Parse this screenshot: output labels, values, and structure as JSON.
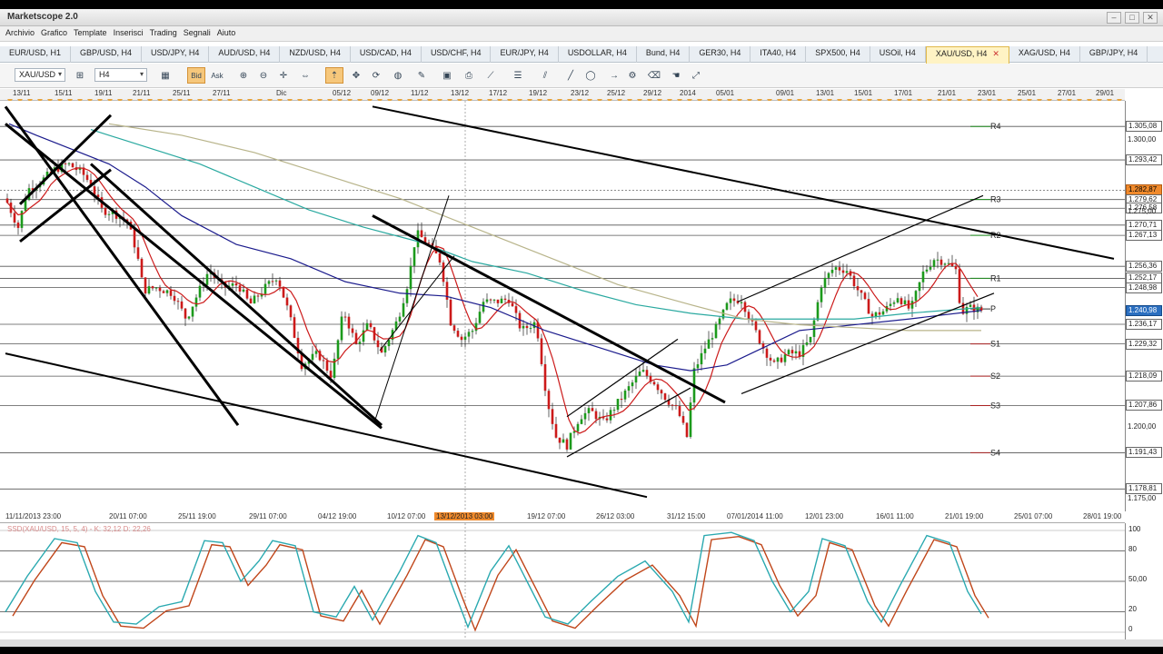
{
  "app": {
    "title": "Marketscope 2.0"
  },
  "menu": [
    "Archivio",
    "Grafico",
    "Template",
    "Inserisci",
    "Trading",
    "Segnali",
    "Aiuto"
  ],
  "tabs": [
    {
      "label": "EUR/USD, H1"
    },
    {
      "label": "GBP/USD, H4"
    },
    {
      "label": "USD/JPY, H4"
    },
    {
      "label": "AUD/USD, H4"
    },
    {
      "label": "NZD/USD, H4"
    },
    {
      "label": "USD/CAD, H4"
    },
    {
      "label": "USD/CHF, H4"
    },
    {
      "label": "EUR/JPY, H4"
    },
    {
      "label": "USDOLLAR, H4"
    },
    {
      "label": "Bund, H4"
    },
    {
      "label": "GER30, H4"
    },
    {
      "label": "ITA40, H4"
    },
    {
      "label": "SPX500, H4"
    },
    {
      "label": "USOil, H4"
    },
    {
      "label": "XAU/USD, H4",
      "active": true
    },
    {
      "label": "XAG/USD, H4"
    },
    {
      "label": "GBP/JPY, H4"
    }
  ],
  "toolbar": {
    "symbol": "XAU/USD",
    "timeframe": "H4",
    "bid_label": "Bid",
    "ask_label": "Ask"
  },
  "top_dates": [
    "13/11",
    "15/11",
    "19/11",
    "21/11",
    "25/11",
    "27/11",
    "Dic",
    "05/12",
    "09/12",
    "11/12",
    "13/12",
    "17/12",
    "19/12",
    "23/12",
    "25/12",
    "29/12",
    "2014",
    "05/01",
    "09/01",
    "13/01",
    "15/01",
    "17/01",
    "21/01",
    "23/01",
    "25/01",
    "27/01",
    "29/01"
  ],
  "bottom_dates": [
    "11/11/2013 23:00",
    "20/11 07:00",
    "25/11 19:00",
    "29/11 07:00",
    "04/12 19:00",
    "10/12 07:00",
    "13/12/2013 03:00",
    "19/12 07:00",
    "26/12 03:00",
    "31/12 15:00",
    "07/01/2014 11:00",
    "12/01 23:00",
    "16/01 11:00",
    "21/01 19:00",
    "25/01 07:00",
    "28/01 19:00"
  ],
  "price_labels": [
    {
      "text": "1.305,08",
      "box": true,
      "price": 1305.08
    },
    {
      "text": "1.300,00",
      "box": false,
      "price": 1300.0
    },
    {
      "text": "1.293,42",
      "box": true,
      "price": 1293.42
    },
    {
      "text": "1.282,87",
      "style": "hl",
      "price": 1282.87
    },
    {
      "text": "1.279,62",
      "box": true,
      "price": 1279.62
    },
    {
      "text": "1.276,58",
      "box": true,
      "price": 1276.58
    },
    {
      "text": "1.275,00",
      "box": false,
      "price": 1275.0
    },
    {
      "text": "1.270,71",
      "box": true,
      "price": 1270.71
    },
    {
      "text": "1.267,13",
      "box": true,
      "price": 1267.13
    },
    {
      "text": "1.256,36",
      "box": true,
      "price": 1256.36
    },
    {
      "text": "1.252,17",
      "box": true,
      "price": 1252.17
    },
    {
      "text": "1.248,98",
      "box": true,
      "price": 1248.98
    },
    {
      "text": "1.240,98",
      "style": "hlb",
      "price": 1240.98
    },
    {
      "text": "1.236,17",
      "box": true,
      "price": 1236.17
    },
    {
      "text": "1.229,32",
      "box": true,
      "price": 1229.32
    },
    {
      "text": "1.218,09",
      "box": true,
      "price": 1218.09
    },
    {
      "text": "1.207,86",
      "box": true,
      "price": 1207.86
    },
    {
      "text": "1.200,00",
      "box": false,
      "price": 1200.0
    },
    {
      "text": "1.191,43",
      "box": true,
      "price": 1191.43
    },
    {
      "text": "1.178,81",
      "box": true,
      "price": 1178.81
    },
    {
      "text": "1.175,00",
      "box": false,
      "price": 1175.0
    }
  ],
  "pivots": [
    {
      "label": "R4",
      "price": 1305.08
    },
    {
      "label": "R3",
      "price": 1279.62
    },
    {
      "label": "R2",
      "price": 1267.13
    },
    {
      "label": "R1",
      "price": 1252.17
    },
    {
      "label": "P",
      "price": 1241.5
    },
    {
      "label": "S1",
      "price": 1229.32
    },
    {
      "label": "S2",
      "price": 1218.09
    },
    {
      "label": "S3",
      "price": 1207.86
    },
    {
      "label": "S4",
      "price": 1191.43
    }
  ],
  "oscillator": {
    "label": "SSD(XAU/USD, 15, 5, 4)  - K: 32,12  D: 22,26",
    "axis": [
      "100",
      "80",
      "50,00",
      "20",
      "0"
    ]
  },
  "colors": {
    "accent": "#f08a2c",
    "sma_red": "#cc1a1a",
    "sma_blue": "#1a1a8c",
    "sma_teal": "#2aa9a0",
    "sma_khaki": "#b8b48a",
    "bull": "#1c9a1c",
    "bear": "#cc1a1a"
  }
}
